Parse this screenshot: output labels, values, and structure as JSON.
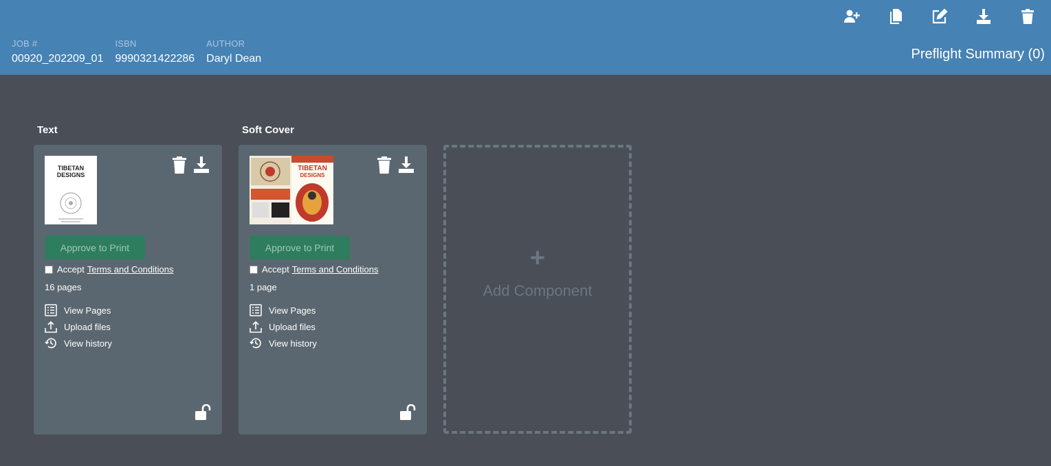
{
  "header": {
    "job_label": "JOB #",
    "job_value": "00920_202209_01",
    "isbn_label": "ISBN",
    "isbn_value": "9990321422286",
    "author_label": "AUTHOR",
    "author_value": "Daryl Dean",
    "preflight": "Preflight Summary (0)",
    "icons": [
      "add-user-icon",
      "copy-icon",
      "edit-icon",
      "download-icon",
      "trash-icon"
    ]
  },
  "components": [
    {
      "title": "Text",
      "thumb": {
        "title": "TIBETAN",
        "subtitle": "DESIGNS"
      },
      "approve": "Approve to Print",
      "accept": "Accept",
      "terms": "Terms and Conditions",
      "pages": "16 pages",
      "view_pages": "View Pages",
      "upload": "Upload files",
      "history": "View history"
    },
    {
      "title": "Soft Cover",
      "thumb": {
        "title": "TIBETAN",
        "subtitle": "DESIGNS"
      },
      "approve": "Approve to Print",
      "accept": "Accept",
      "terms": "Terms and Conditions",
      "pages": "1 page",
      "view_pages": "View Pages",
      "upload": "Upload files",
      "history": "View history"
    }
  ],
  "add_component": {
    "plus": "+",
    "label": "Add Component"
  },
  "colors": {
    "header": "#4682b4",
    "background": "#4a4e57",
    "card": "#5b6770",
    "approve": "#2e7d5e"
  }
}
